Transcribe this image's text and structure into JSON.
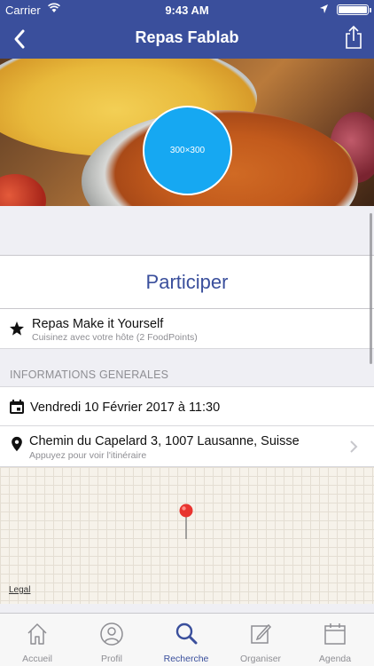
{
  "status_bar": {
    "carrier": "Carrier",
    "time": "9:43 AM"
  },
  "nav": {
    "title": "Repas Fablab"
  },
  "hero": {
    "avatar_text": "300×300"
  },
  "participate_label": "Participer",
  "meal_type": {
    "title": "Repas Make it Yourself",
    "subtitle": "Cuisinez avec votre hôte (2 FoodPoints)"
  },
  "section_header": "INFORMATIONS GENERALES",
  "date_row": {
    "text": "Vendredi 10 Février 2017 à 11:30"
  },
  "address_row": {
    "text": "Chemin du Capelard 3, 1007 Lausanne, Suisse",
    "subtitle": "Appuyez pour voir l'itinéraire"
  },
  "map": {
    "legal": "Legal"
  },
  "tabs": [
    {
      "label": "Accueil",
      "icon": "home-icon",
      "active": false
    },
    {
      "label": "Profil",
      "icon": "profile-icon",
      "active": false
    },
    {
      "label": "Recherche",
      "icon": "search-icon",
      "active": true
    },
    {
      "label": "Organiser",
      "icon": "edit-icon",
      "active": false
    },
    {
      "label": "Agenda",
      "icon": "calendar-icon",
      "active": false
    }
  ],
  "colors": {
    "brand": "#3a4f9c",
    "avatar": "#16a8f2",
    "pin": "#e8342f"
  }
}
